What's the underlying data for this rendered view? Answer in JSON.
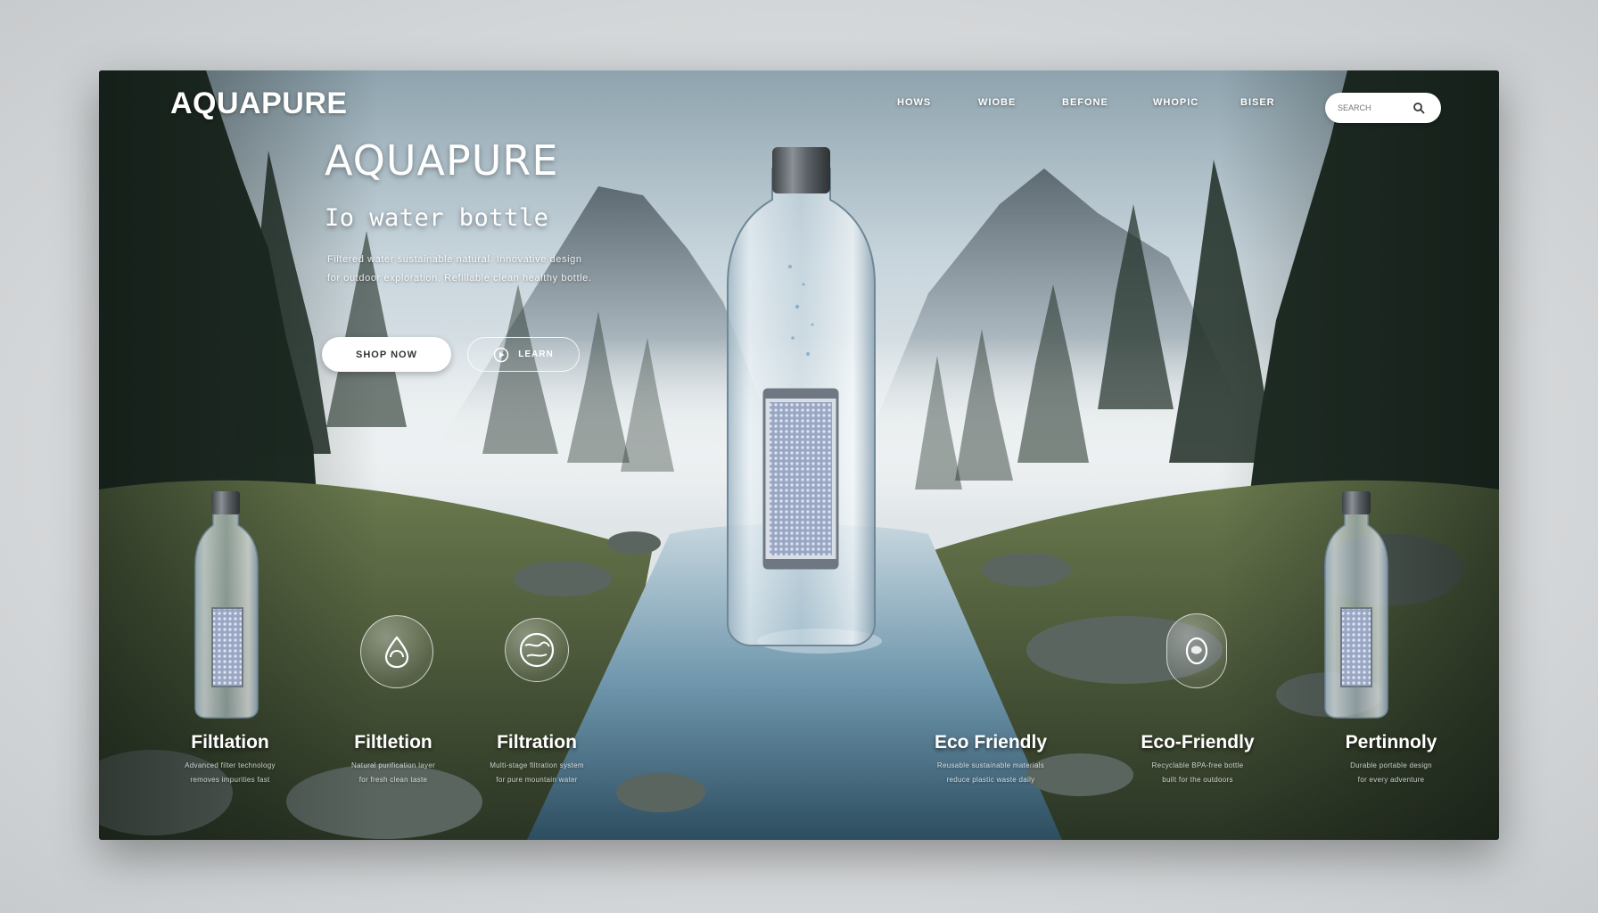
{
  "header": {
    "brand": "AQUAPURE",
    "nav": [
      "HOWS",
      "WIOBE",
      "BEFONE",
      "WHOPIC",
      "BISER"
    ],
    "search_placeholder": "SEARCH"
  },
  "hero": {
    "title": "AQUAPURE",
    "subtitle": "Io water bottle",
    "description": "Filtered water sustainable natural. Innovative design for outdoor exploration. Refillable clean healthy bottle.",
    "primary_button": "SHOP NOW",
    "secondary_button": "LEARN"
  },
  "features": [
    {
      "icon": "water-drop-icon",
      "title": "Filtlation",
      "desc": [
        "Advanced filter technology",
        "removes impurities fast"
      ]
    },
    {
      "icon": "leaf-drop-icon",
      "title": "Filtletion",
      "desc": [
        "Natural purification layer",
        "for fresh clean taste"
      ]
    },
    {
      "icon": "globe-filter-icon",
      "title": "Filtration",
      "desc": [
        "Multi-stage filtration system",
        "for pure mountain water"
      ]
    },
    {
      "icon": "",
      "title": "Eco Friendly",
      "desc": [
        "Reusable sustainable materials",
        "reduce plastic waste daily"
      ]
    },
    {
      "icon": "fish-recycle-icon",
      "title": "Eco-Friendly",
      "desc": [
        "Recyclable BPA-free bottle",
        "built for the outdoors"
      ]
    },
    {
      "icon": "",
      "title": "Pertinnoly",
      "desc": [
        "Durable portable design",
        "for every adventure"
      ]
    }
  ],
  "colors": {
    "accent": "#ffffff",
    "sky": "#c9d6dd",
    "forest": "#1f2d25",
    "water": "#6f97ad"
  }
}
